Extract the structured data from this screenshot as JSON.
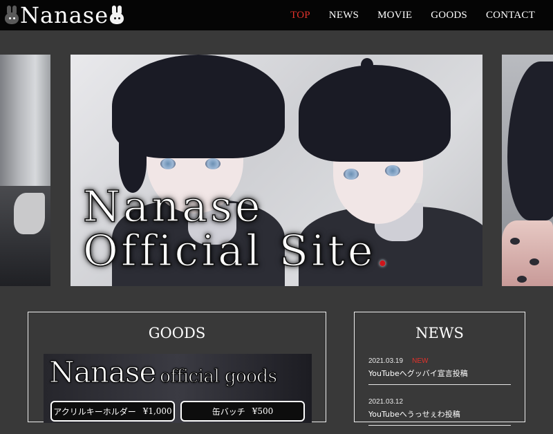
{
  "header": {
    "logo_text": "Nanase",
    "nav": [
      {
        "label": "TOP",
        "active": true
      },
      {
        "label": "NEWS",
        "active": false
      },
      {
        "label": "MOVIE",
        "active": false
      },
      {
        "label": "GOODS",
        "active": false
      },
      {
        "label": "CONTACT",
        "active": false
      }
    ],
    "active_color": "#e2322b"
  },
  "hero": {
    "title_line1": "Nanase",
    "title_line2": "Official Site",
    "title_dot": "."
  },
  "goods": {
    "title": "GOODS",
    "banner_big": "Nanase",
    "banner_small": "official goods",
    "items": [
      {
        "name": "アクリルキーホルダー",
        "price": "¥1,000"
      },
      {
        "name": "缶バッチ",
        "price": "¥500"
      }
    ]
  },
  "news": {
    "title": "NEWS",
    "items": [
      {
        "date": "2021.03.19",
        "badge": "NEW",
        "title": "YouTubeへグッバイ宣言投稿"
      },
      {
        "date": "2021.03.12",
        "badge": "",
        "title": "YouTubeへうっせぇわ投稿"
      }
    ]
  }
}
